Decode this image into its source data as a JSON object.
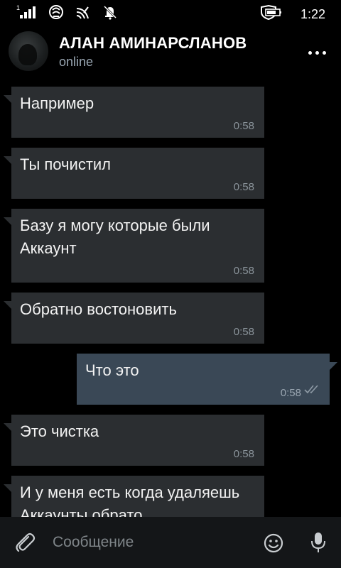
{
  "status_bar": {
    "signal_sub": "1",
    "time": "1:22"
  },
  "header": {
    "name": "АЛАН АМИНАРСЛАНОВ",
    "status": "online"
  },
  "messages": [
    {
      "text": "Например",
      "time": "0:58",
      "direction": "in"
    },
    {
      "text": "Ты почистил",
      "time": "0:58",
      "direction": "in"
    },
    {
      "text": "Базу я могу которые были Аккаунт",
      "time": "0:58",
      "direction": "in"
    },
    {
      "text": "Обратно востоновить",
      "time": "0:58",
      "direction": "in"
    },
    {
      "text": "Что это",
      "time": "0:58",
      "direction": "out"
    },
    {
      "text": "Это чистка",
      "time": "0:58",
      "direction": "in"
    },
    {
      "text": "И у меня есть когда удаляешь Аккаунты обрато",
      "time": "",
      "direction": "in"
    }
  ],
  "input": {
    "placeholder": "Сообщение"
  },
  "colors": {
    "incoming_bubble": "#2b2e31",
    "outgoing_bubble": "#3a4856",
    "input_bar": "#141618",
    "status_online": "#9aa7b3"
  }
}
